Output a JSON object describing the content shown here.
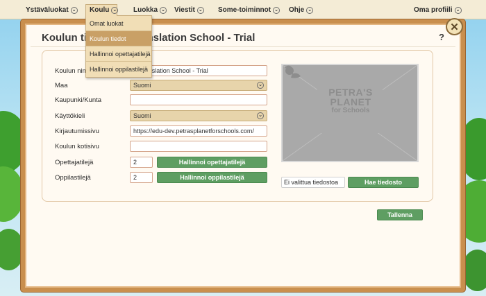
{
  "menu": {
    "items": [
      {
        "label": "Ystäväluokat"
      },
      {
        "label": "Koulu"
      },
      {
        "label": "Luokka"
      },
      {
        "label": "Viestit"
      },
      {
        "label": "Some-toiminnot"
      },
      {
        "label": "Ohje"
      },
      {
        "label": "Oma profiili"
      }
    ],
    "active": "Koulu"
  },
  "dropdown": {
    "items": [
      {
        "label": "Omat luokat"
      },
      {
        "label": "Koulun tiedot"
      },
      {
        "label": "Hallinnoi opettajatilejä"
      },
      {
        "label": "Hallinnoi oppilastilejä"
      }
    ],
    "highlighted": "Koulun tiedot"
  },
  "panel": {
    "title_visible": "Koulun tie",
    "title_tail": "ranslation School - Trial",
    "help": "?",
    "close_symbol": "✕"
  },
  "form": {
    "school_name": {
      "label": "Koulun nim",
      "value": "'s Translation School - Trial"
    },
    "country": {
      "label": "Maa",
      "value": "Suomi"
    },
    "city": {
      "label": "Kaupunki/Kunta",
      "value": ""
    },
    "language": {
      "label": "Käyttökieli",
      "value": "Suomi"
    },
    "login_page": {
      "label": "Kirjautumissivu",
      "value": "https://edu-dev.petrasplanetforschools.com/"
    },
    "homepage": {
      "label": "Koulun kotisivu",
      "value": ""
    },
    "teacher_accounts": {
      "label": "Opettajatilejä",
      "value": "2",
      "button": "Hallinnoi opettajatilejä"
    },
    "student_accounts": {
      "label": "Oppilastilejä",
      "value": "2",
      "button": "Hallinnoi oppilastilejä"
    }
  },
  "image": {
    "logo_line1": "PETRA'S",
    "logo_line2": "PLANET",
    "logo_line3": "for Schools",
    "file_status": "Ei valittua tiedostoa",
    "choose_button": "Hae tiedosto"
  },
  "actions": {
    "save": "Tallenna"
  }
}
